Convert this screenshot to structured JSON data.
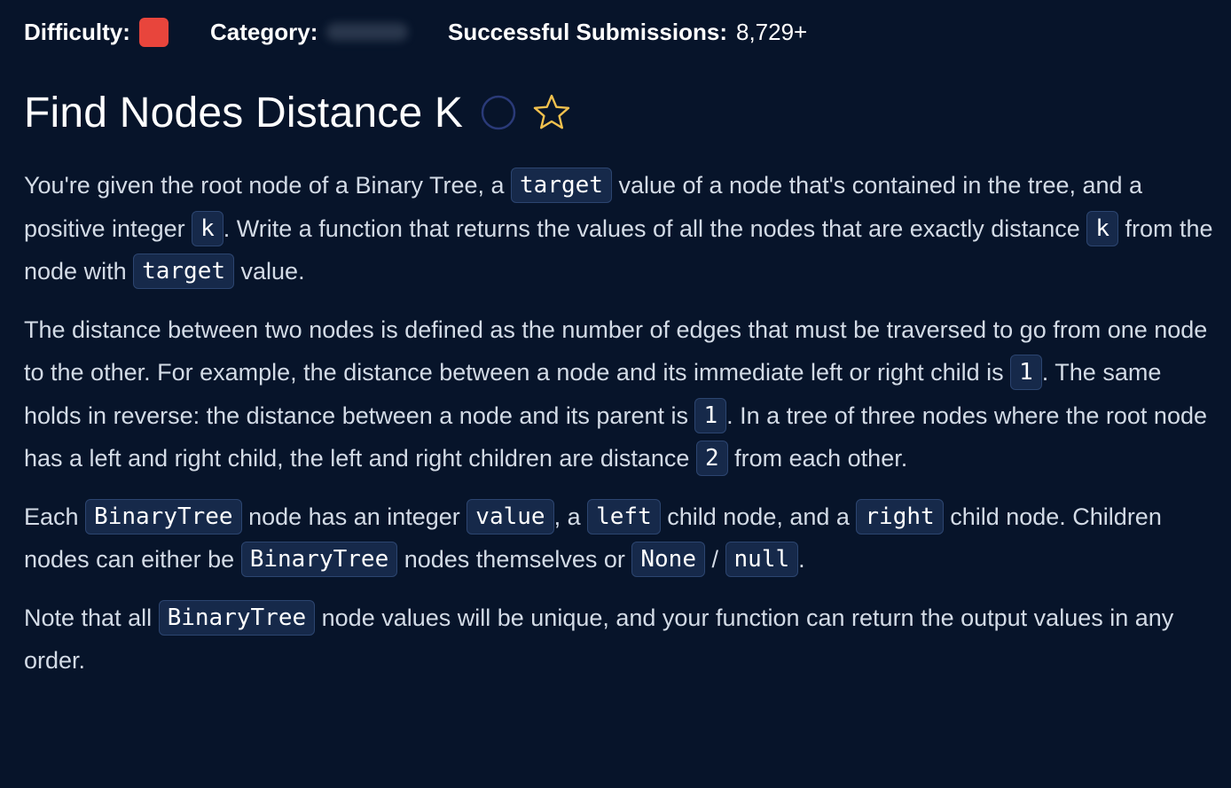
{
  "header": {
    "difficulty_label": "Difficulty:",
    "difficulty_color": "#e8453c",
    "category_label": "Category:",
    "submissions_label": "Successful Submissions:",
    "submissions_value": "8,729+"
  },
  "question": {
    "title": "Find Nodes Distance K",
    "status_icon": "circle-outline-icon",
    "favorite_icon": "star-outline-icon"
  },
  "prompt": {
    "p1": {
      "t1": "You're given the root node of a Binary Tree, a ",
      "c1": "target",
      "t2": " value of a node that's contained in the tree, and a positive integer ",
      "c2": "k",
      "t3": ". Write a function that returns the values of all the nodes that are exactly distance ",
      "c3": "k",
      "t4": " from the node with ",
      "c4": "target",
      "t5": " value."
    },
    "p2": {
      "t1": "The distance between two nodes is defined as the number of edges that must be traversed to go from one node to the other. For example, the distance between a node and its immediate left or right child is ",
      "c1": "1",
      "t2": ". The same holds in reverse: the distance between a node and its parent is ",
      "c2": "1",
      "t3": ". In a tree of three nodes where the root node has a left and right child, the left and right children are distance ",
      "c3": "2",
      "t4": " from each other."
    },
    "p3": {
      "t1": "Each ",
      "c1": "BinaryTree",
      "t2": " node has an integer ",
      "c2": "value",
      "t3": ", a ",
      "c3": "left",
      "t4": " child node, and a ",
      "c4": "right",
      "t5": " child node. Children nodes can either be ",
      "c5": "BinaryTree",
      "t6": " nodes themselves or ",
      "c6": "None",
      "t7": " / ",
      "c7": "null",
      "t8": "."
    },
    "p4": {
      "t1": "Note that all ",
      "c1": "BinaryTree",
      "t2": " node values will be unique, and your function can return the output values in any order."
    }
  },
  "colors": {
    "background": "#07142a",
    "code_background": "#16294a",
    "star": "#f2c14e",
    "status_circle": "#2a3a78"
  }
}
